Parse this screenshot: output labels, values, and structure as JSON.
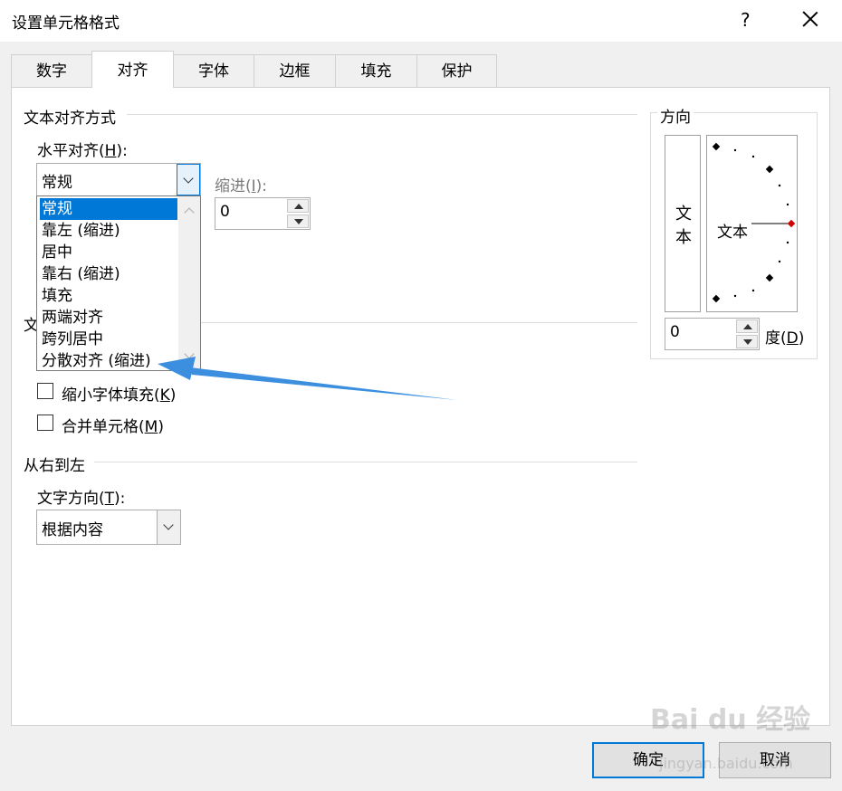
{
  "window": {
    "title": "设置单元格格式",
    "help": "?",
    "close": "✕"
  },
  "tabs": [
    {
      "label": "数字"
    },
    {
      "label": "对齐"
    },
    {
      "label": "字体"
    },
    {
      "label": "边框"
    },
    {
      "label": "填充"
    },
    {
      "label": "保护"
    }
  ],
  "active_tab": "对齐",
  "text_alignment": {
    "group_label": "文本对齐方式",
    "horizontal": {
      "label": "水平对齐(",
      "mnemonic": "H",
      "label_end": "):",
      "value": "常规",
      "options": [
        "常规",
        "靠左 (缩进)",
        "居中",
        "靠右 (缩进)",
        "填充",
        "两端对齐",
        "跨列居中",
        "分散对齐 (缩进)"
      ],
      "selected_option": "常规"
    },
    "indent": {
      "label": "缩进(",
      "mnemonic": "I",
      "label_end": "):",
      "value": "0"
    }
  },
  "text_control": {
    "group_label_partial": "文",
    "shrink_to_fit": {
      "label": "缩小字体填充(",
      "mnemonic": "K",
      "label_end": ")",
      "checked": false
    },
    "merge_cells": {
      "label": "合并单元格(",
      "mnemonic": "M",
      "label_end": ")",
      "checked": false
    }
  },
  "rtl": {
    "group_label": "从右到左",
    "text_direction": {
      "label": "文字方向(",
      "mnemonic": "T",
      "label_end": "):",
      "value": "根据内容"
    }
  },
  "orientation": {
    "group_label": "方向",
    "vertical_text": "文本",
    "dial_text": "文本",
    "degrees_value": "0",
    "degrees_label": "度(",
    "degrees_mnemonic": "D",
    "degrees_label_end": ")"
  },
  "buttons": {
    "ok": "确定",
    "cancel": "取消"
  },
  "watermark": {
    "brand": "Bai du 经验",
    "url": "jingyan.baidu.com"
  },
  "colors": {
    "selection": "#0078d7",
    "arrow": "#3b8fde",
    "dial_marker": "#d00000"
  }
}
